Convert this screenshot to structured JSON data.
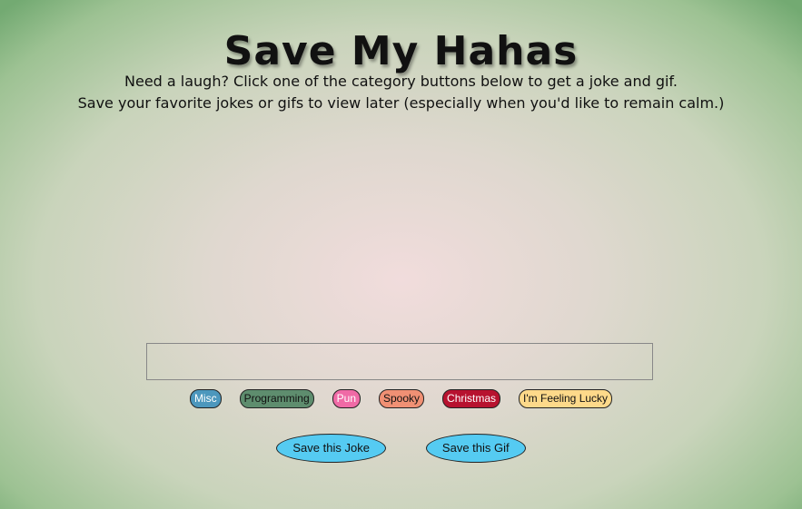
{
  "page": {
    "title": "Save My Hahas",
    "intro_line1": "Need a laugh? Click one of the category buttons below to get a joke and gif.",
    "intro_line2": "Save your favorite jokes or gifs to view later (especially when you'd like to remain calm.)"
  },
  "joke_box": {
    "text": ""
  },
  "categories": [
    {
      "label": "Misc",
      "color": "#4c97bd",
      "text_color": "#ffffff"
    },
    {
      "label": "Programming",
      "color": "#5e8d6e",
      "text_color": "#111111"
    },
    {
      "label": "Pun",
      "color": "#f06aa6",
      "text_color": "#ffffff"
    },
    {
      "label": "Spooky",
      "color": "#f09074",
      "text_color": "#111111"
    },
    {
      "label": "Christmas",
      "color": "#b7122f",
      "text_color": "#ffffff"
    },
    {
      "label": "I'm Feeling Lucky",
      "color": "#fdd98a",
      "text_color": "#111111"
    }
  ],
  "save_buttons": {
    "joke_label": "Save this Joke",
    "gif_label": "Save this Gif",
    "color": "#55cbf2"
  }
}
